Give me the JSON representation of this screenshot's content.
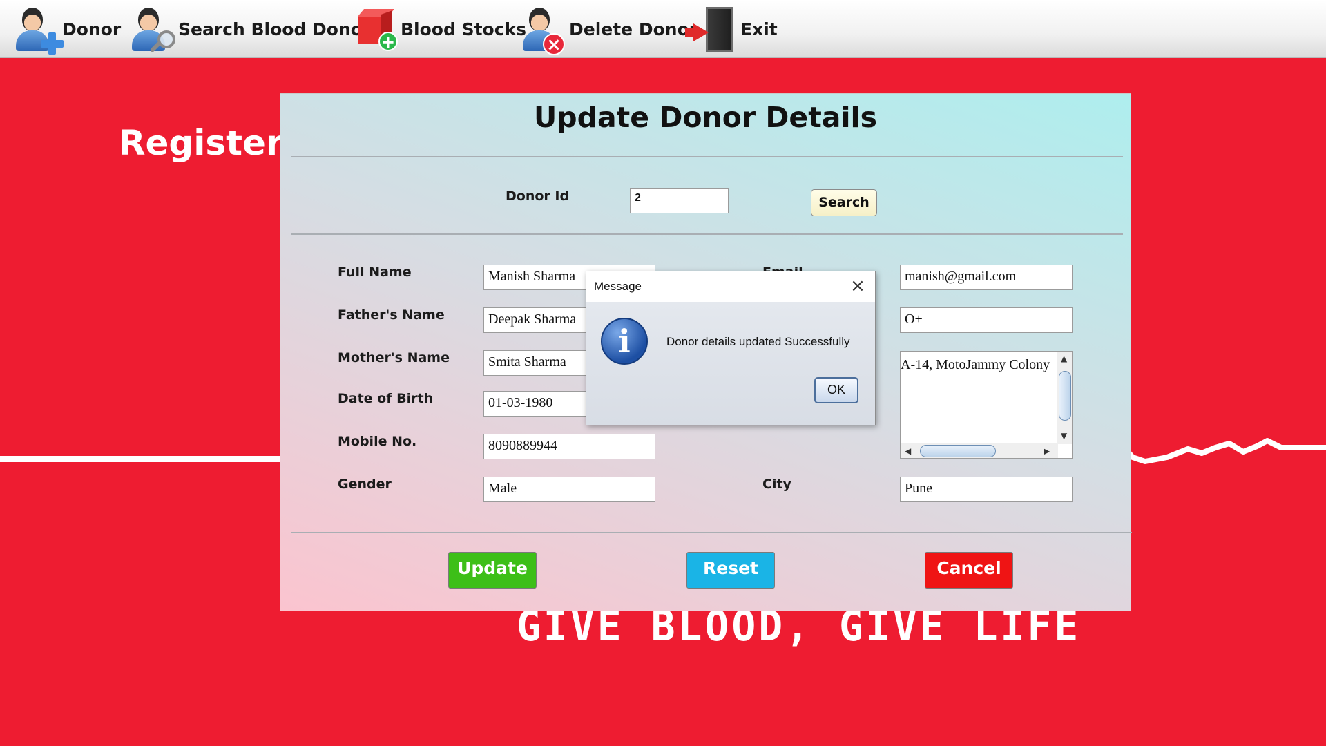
{
  "menu": {
    "donor": "Donor",
    "search_donor": "Search Blood Donor",
    "blood_stocks": "Blood Stocks",
    "delete_donor": "Delete Donor",
    "exit": "Exit"
  },
  "background": {
    "title": "Register fo",
    "slogan": "GIVE BLOOD, GIVE LIFE"
  },
  "dialog": {
    "title": "Update Donor Details",
    "donor_id_label": "Donor Id",
    "donor_id_value": "2",
    "search_label": "Search",
    "fields": {
      "full_name": {
        "label": "Full Name",
        "value": "Manish Sharma"
      },
      "father_name": {
        "label": "Father's Name",
        "value": "Deepak Sharma"
      },
      "mother_name": {
        "label": "Mother's Name",
        "value": "Smita Sharma"
      },
      "dob": {
        "label": "Date of Birth",
        "value": "01-03-1980"
      },
      "mobile": {
        "label": "Mobile No.",
        "value": "8090889944"
      },
      "gender": {
        "label": "Gender",
        "value": "Male"
      },
      "email": {
        "label": "Email",
        "value": "manish@gmail.com"
      },
      "blood_group": {
        "value": "O+"
      },
      "address": {
        "value": "A-14, MotoJammy Colony"
      },
      "city": {
        "label": "City",
        "value": "Pune"
      }
    },
    "buttons": {
      "update": "Update",
      "reset": "Reset",
      "cancel": "Cancel"
    },
    "button_colors": {
      "update": "#3dbf18",
      "reset": "#1ab4e6",
      "cancel": "#ef1414"
    }
  },
  "message": {
    "title": "Message",
    "text": "Donor details updated Successfully",
    "ok": "OK",
    "icon": "info-icon",
    "close": "×"
  },
  "colors": {
    "background": "#ee1c31"
  }
}
